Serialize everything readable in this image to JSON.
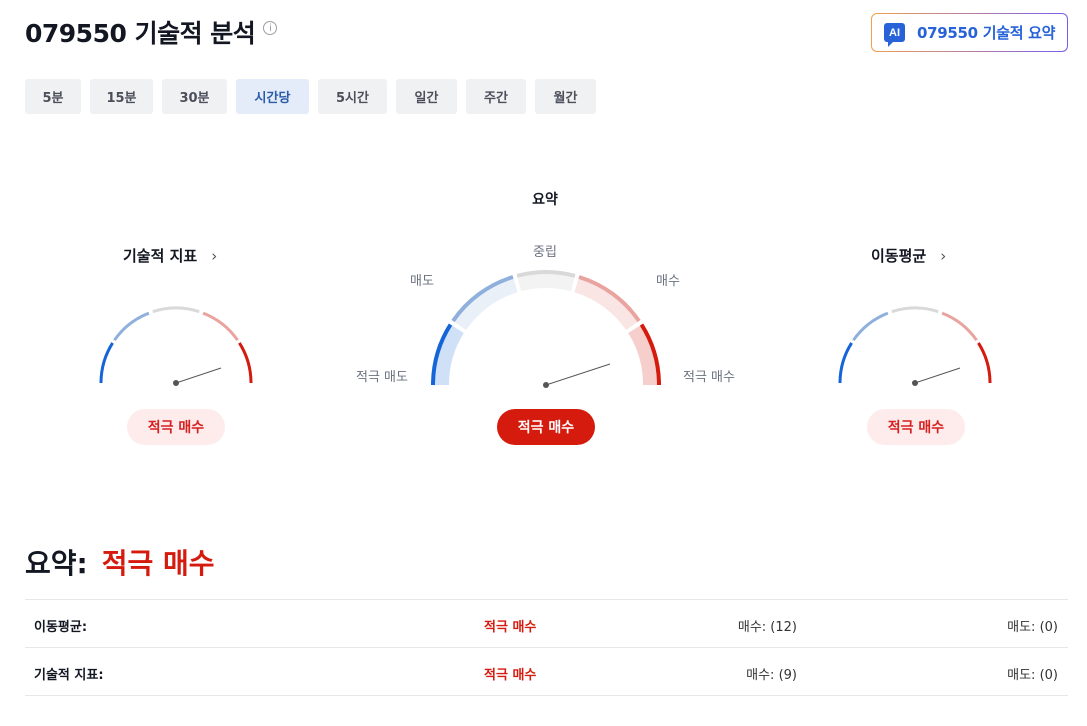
{
  "header": {
    "title": "079550 기술적 분석",
    "info_icon": "info-circle-icon",
    "ai_button": {
      "badge": "AI",
      "label": "079550 기술적 요약",
      "icon": "ai-chat-icon"
    }
  },
  "tabs": [
    {
      "label": "5분",
      "active": false
    },
    {
      "label": "15분",
      "active": false
    },
    {
      "label": "30분",
      "active": false
    },
    {
      "label": "시간당",
      "active": true
    },
    {
      "label": "5시간",
      "active": false
    },
    {
      "label": "일간",
      "active": false
    },
    {
      "label": "주간",
      "active": false
    },
    {
      "label": "월간",
      "active": false
    }
  ],
  "gauges": {
    "summary_title": "요약",
    "labels": {
      "neutral": "중립",
      "sell": "매도",
      "buy": "매수",
      "strong_sell": "적극 매도",
      "strong_buy": "적극 매수"
    },
    "technical": {
      "title": "기술적 지표",
      "chevron": "chevron-right-icon",
      "signal": "적극 매수"
    },
    "summary": {
      "signal": "적극 매수"
    },
    "moving_average": {
      "title": "이동평균",
      "chevron": "chevron-right-icon",
      "signal": "적극 매수"
    },
    "colors": {
      "strong_sell": "#1565d8",
      "sell": "#8fb0dc",
      "neutral": "#d9d9d9",
      "buy": "#e9a4a0",
      "strong_buy": "#d51a0e"
    }
  },
  "summary": {
    "label": "요약:",
    "value": "적극 매수",
    "rows": [
      {
        "name": "이동평균:",
        "signal": "적극 매수",
        "buy": "매수: (12)",
        "sell": "매도: (0)"
      },
      {
        "name": "기술적 지표:",
        "signal": "적극 매수",
        "buy": "매수: (9)",
        "sell": "매도: (0)"
      }
    ]
  }
}
